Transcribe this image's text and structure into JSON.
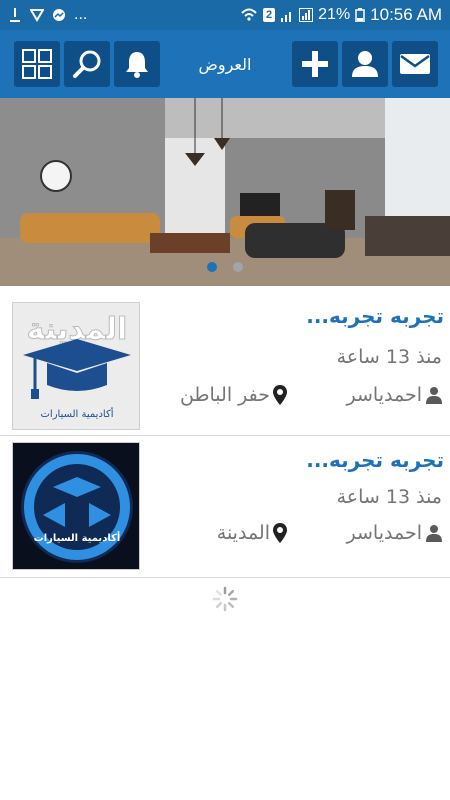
{
  "status_bar": {
    "notif_count": "2",
    "battery": "21%",
    "time": "10:56 AM",
    "more": "..."
  },
  "header": {
    "title": "العروض",
    "icons": [
      "grid-icon",
      "search-icon",
      "bell-icon",
      "plus-icon",
      "user-icon",
      "mail-icon"
    ]
  },
  "banner": {
    "slides": 2,
    "active_slide": 1
  },
  "listings": [
    {
      "title": "تجربه تجربه...",
      "time": "منذ 13 ساعة",
      "user": "احمدياسر",
      "location": "حفر الباطن",
      "thumb_text_top": "المدينة",
      "thumb_text_bottom": "أكاديمية السيارات"
    },
    {
      "title": "تجربه تجربه...",
      "time": "منذ 13 ساعة",
      "user": "احمدياسر",
      "location": "المدينة",
      "thumb_text_bottom": "أكاديمية السيارات"
    }
  ],
  "colors": {
    "status_bar": "#1a6aa8",
    "app_bar": "#1d72b8",
    "header_button": "#0d4f86",
    "title_blue": "#1d72b8",
    "meta_gray": "#757575"
  }
}
